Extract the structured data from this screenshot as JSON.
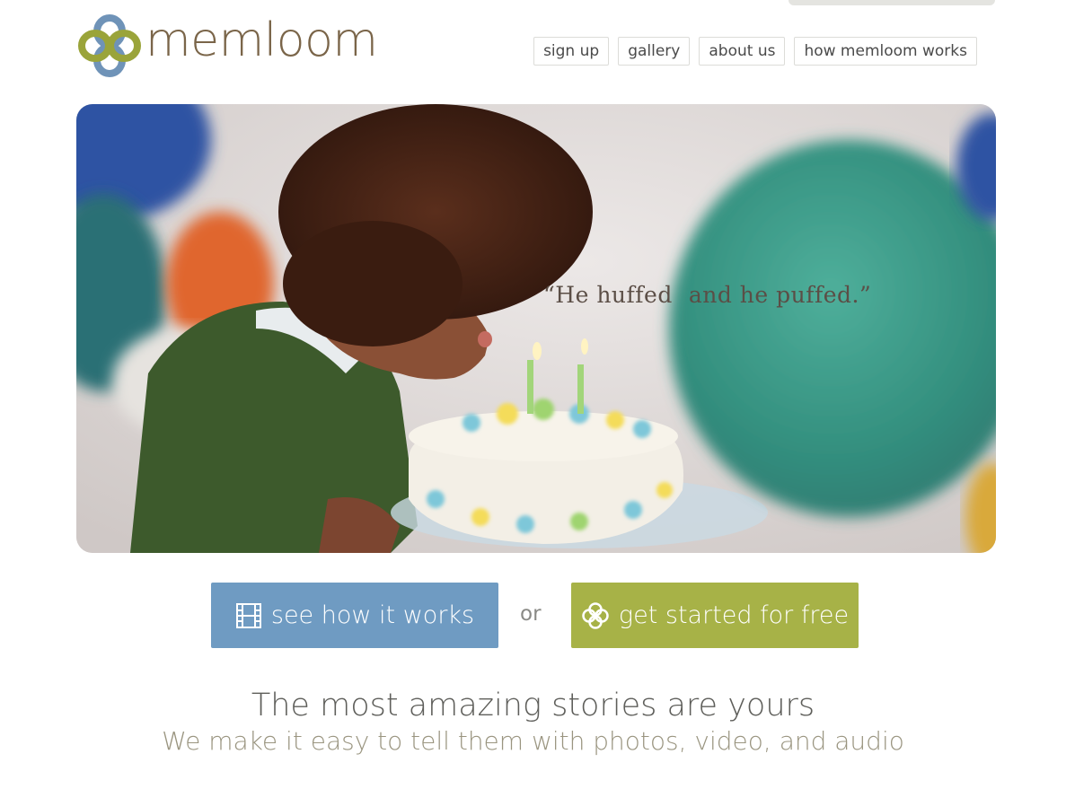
{
  "brand": {
    "name": "memloom",
    "logo_icon": "interlocking-loops-icon",
    "colors": {
      "loop_green": "#9aa43a",
      "loop_blue": "#6f93b8",
      "wordmark": "#7a6549"
    }
  },
  "nav": {
    "items": [
      {
        "label": "sign up"
      },
      {
        "label": "gallery"
      },
      {
        "label": "about us"
      },
      {
        "label": "how memloom works"
      }
    ]
  },
  "hero": {
    "quote_part1": "“He huffed",
    "quote_part2": "and he puffed.”"
  },
  "cta": {
    "video_label": "see how it works",
    "video_icon": "film-icon",
    "or_label": "or",
    "start_label": "get started for free",
    "start_icon": "clover-icon",
    "colors": {
      "video": "#6f9bc2",
      "start": "#a7b247"
    }
  },
  "tagline": {
    "headline": "The most amazing stories are yours",
    "subhead": "We make it easy to tell them with photos, video, and audio"
  }
}
